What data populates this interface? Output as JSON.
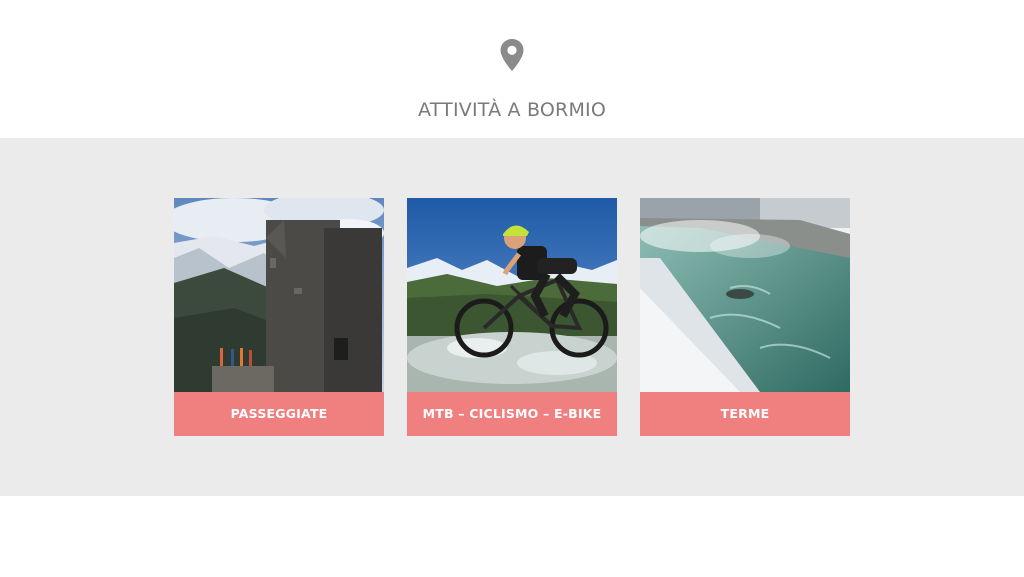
{
  "header": {
    "icon": "map-pin-icon",
    "title": "ATTIVITÀ A BORMIO"
  },
  "colors": {
    "accent": "#f07f80",
    "band": "#ebebeb",
    "title": "#7a7a7a"
  },
  "cards": [
    {
      "label": "PASSEGGIATE",
      "image": "hikers-by-stone-tower"
    },
    {
      "label": "MTB – CICLISMO – E-BIKE",
      "image": "mountain-biker-in-stream"
    },
    {
      "label": "TERME",
      "image": "thermal-pool-in-snow"
    }
  ]
}
